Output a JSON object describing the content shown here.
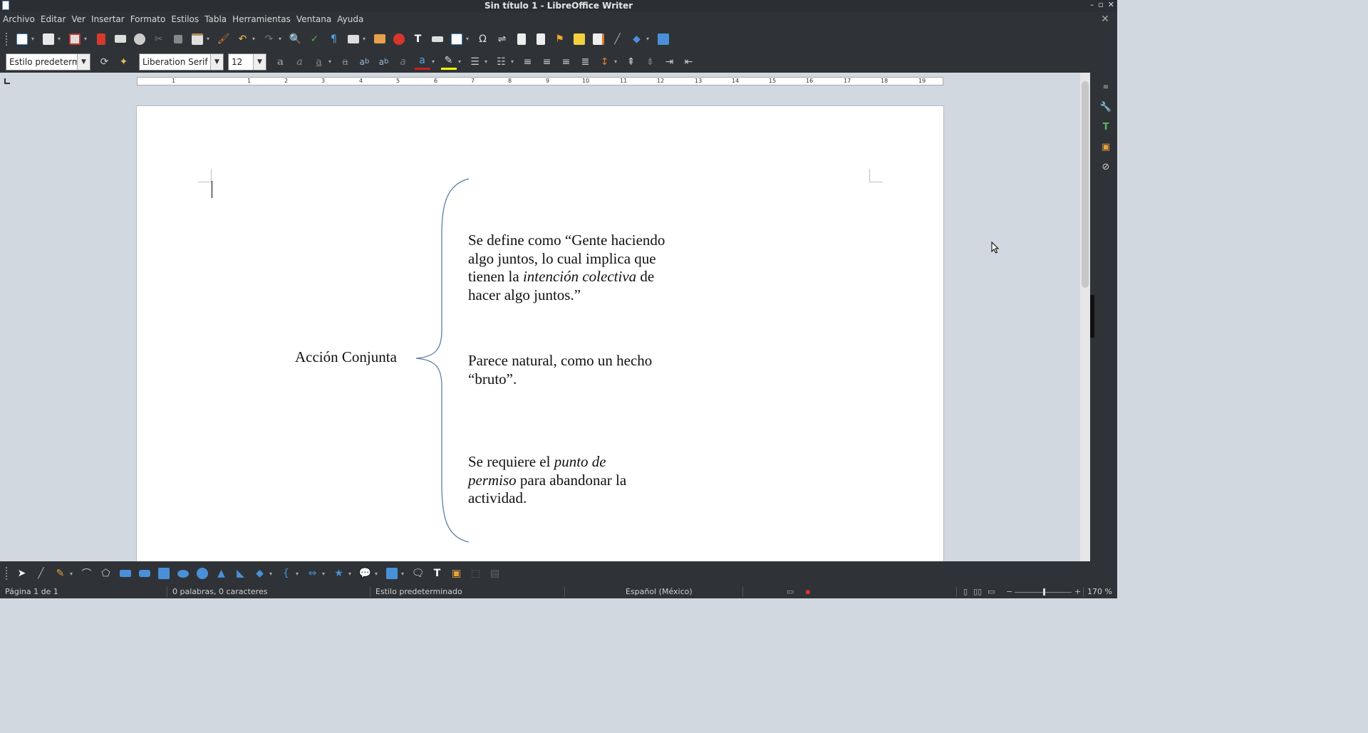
{
  "window": {
    "title": "Sin título 1 - LibreOffice Writer",
    "controls": [
      "–",
      "▫",
      "✕"
    ]
  },
  "menubar": {
    "items": [
      "Archivo",
      "Editar",
      "Ver",
      "Insertar",
      "Formato",
      "Estilos",
      "Tabla",
      "Herramientas",
      "Ventana",
      "Ayuda"
    ],
    "close_doc": "✕"
  },
  "formatting": {
    "paragraph_style": "Estilo predetermi",
    "font_name": "Liberation Serif",
    "font_size": "12"
  },
  "ruler": {
    "ticks": [
      "1",
      "1",
      "2",
      "3",
      "4",
      "5",
      "6",
      "7",
      "8",
      "9",
      "10",
      "11",
      "12",
      "13",
      "14",
      "15",
      "16",
      "17",
      "18",
      "19"
    ]
  },
  "document": {
    "left_label": "Acción Conjunta",
    "block1": {
      "part1": "Se define como “Gente haciendo algo juntos, lo cual implica que tienen la ",
      "italic": "intención colectiva",
      "part2": " de hacer algo juntos.”"
    },
    "block2": {
      "text": "Parece natural, como un hecho “bruto”."
    },
    "block3": {
      "part1": "Se requiere el ",
      "italic": "punto de permiso",
      "part2": " para abandonar la actividad."
    }
  },
  "statusbar": {
    "page": "Página 1 de 1",
    "words": "0 palabras, 0 caracteres",
    "style": "Estilo predeterminado",
    "language": "Español (México)",
    "zoom": "170 %"
  },
  "colors": {
    "brace": "#5b7fa6",
    "toolbar_bg": "#2f3337",
    "workspace_bg": "#d1d8df"
  }
}
